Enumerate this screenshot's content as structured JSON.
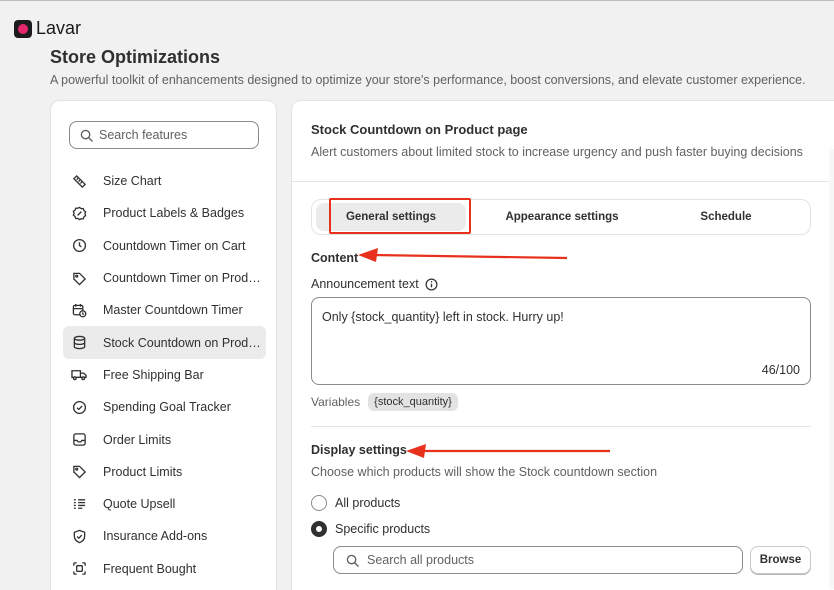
{
  "app": {
    "name": "Lavar",
    "accent": "#e5286b"
  },
  "page": {
    "title": "Store Optimizations",
    "subtitle": "A powerful toolkit of enhancements designed to optimize your store's performance, boost conversions, and elevate customer experience."
  },
  "sidebar": {
    "search_placeholder": "Search features",
    "items": [
      {
        "label": "Size Chart",
        "icon": "ruler-icon",
        "active": false
      },
      {
        "label": "Product Labels & Badges",
        "icon": "badge-icon",
        "active": false
      },
      {
        "label": "Countdown Timer on Cart",
        "icon": "clock-icon",
        "active": false
      },
      {
        "label": "Countdown Timer on Product Page",
        "icon": "tag-icon",
        "active": false
      },
      {
        "label": "Master Countdown Timer",
        "icon": "calendar-clock-icon",
        "active": false
      },
      {
        "label": "Stock Countdown on Product Page",
        "icon": "database-icon",
        "active": true
      },
      {
        "label": "Free Shipping Bar",
        "icon": "truck-icon",
        "active": false
      },
      {
        "label": "Spending Goal Tracker",
        "icon": "check-circle-icon",
        "active": false
      },
      {
        "label": "Order Limits",
        "icon": "inbox-icon",
        "active": false
      },
      {
        "label": "Product Limits",
        "icon": "tag-icon",
        "active": false
      },
      {
        "label": "Quote Upsell",
        "icon": "list-icon",
        "active": false
      },
      {
        "label": "Insurance Add-ons",
        "icon": "shield-check-icon",
        "active": false
      },
      {
        "label": "Frequent Bought",
        "icon": "bundle-icon",
        "active": false
      }
    ]
  },
  "main": {
    "title": "Stock Countdown on Product page",
    "description": "Alert customers about limited stock to increase urgency and push faster buying decisions",
    "tabs": [
      {
        "label": "General settings",
        "active": true
      },
      {
        "label": "Appearance settings",
        "active": false
      },
      {
        "label": "Schedule",
        "active": false
      }
    ],
    "content": {
      "heading": "Content",
      "announcement_label": "Announcement text",
      "announcement_value": "Only {stock_quantity} left in stock. Hurry up!",
      "char_count": "46/100",
      "variables_label": "Variables",
      "variable_chip": "{stock_quantity}"
    },
    "display": {
      "heading": "Display settings",
      "description": "Choose which products will show the Stock countdown section",
      "options": [
        {
          "label": "All products",
          "checked": false
        },
        {
          "label": "Specific products",
          "checked": true
        }
      ],
      "search_placeholder": "Search all products",
      "browse_label": "Browse"
    }
  },
  "annotations": {
    "highlight_color": "#e8311c"
  }
}
